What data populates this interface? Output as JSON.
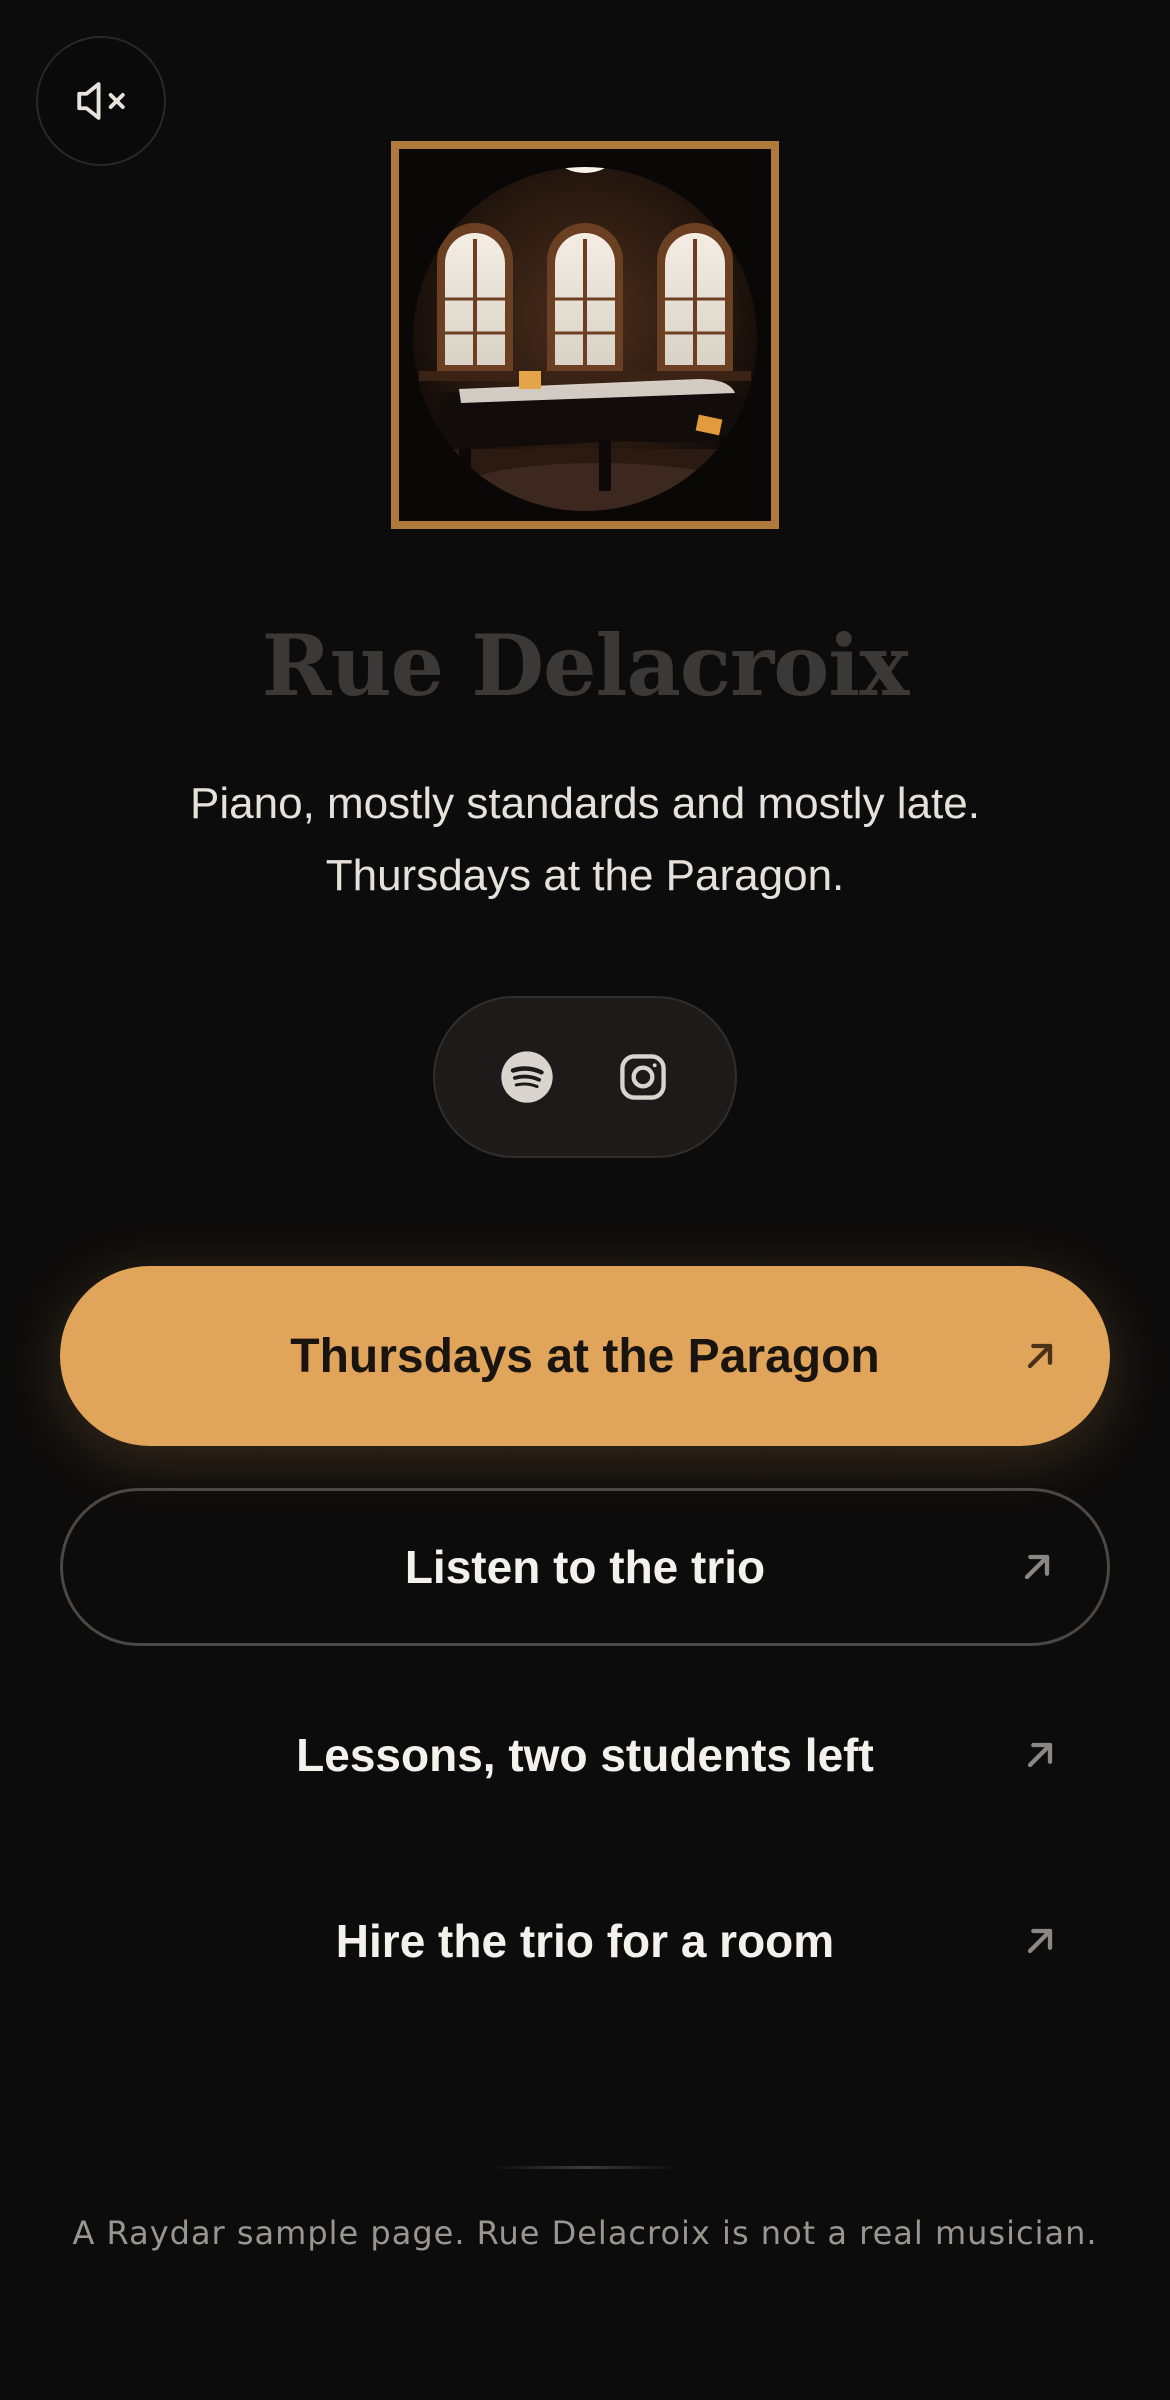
{
  "profile": {
    "name": "Rue Delacroix",
    "bio_line1": "Piano, mostly standards and mostly late.",
    "bio_line2": "Thursdays at the Paragon.",
    "avatar_alt": "Grand piano beneath arched windows"
  },
  "controls": {
    "mute_icon": "speaker-muted-icon"
  },
  "socials": [
    {
      "name": "Spotify",
      "icon": "spotify-icon"
    },
    {
      "name": "Instagram",
      "icon": "instagram-icon"
    }
  ],
  "links": [
    {
      "label": "Thursdays at the Paragon",
      "style": "primary"
    },
    {
      "label": "Listen to the trio",
      "style": "outline"
    },
    {
      "label": "Lessons, two students left",
      "style": "plain"
    },
    {
      "label": "Hire the trio for a room",
      "style": "plain"
    }
  ],
  "footer": {
    "text": "A Raydar sample page. Rue Delacroix is not a real musician."
  },
  "colors": {
    "background": "#0d0c0c",
    "accent": "#e0a55b",
    "frame": "#b07a3c",
    "name": "#3b3937"
  }
}
